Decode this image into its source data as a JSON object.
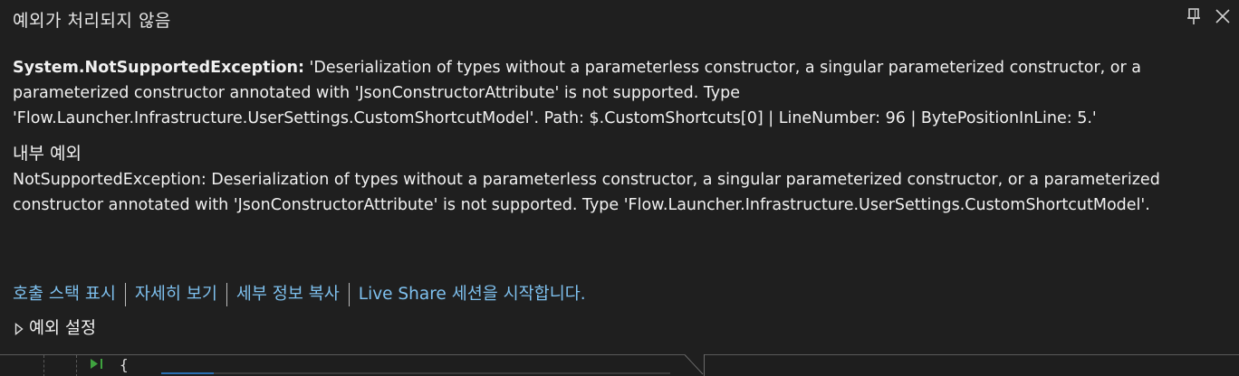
{
  "window": {
    "title": "예외가 처리되지 않음"
  },
  "exception": {
    "type": "System.NotSupportedException:",
    "message": " 'Deserialization of types without a parameterless constructor, a singular parameterized constructor, or a parameterized constructor annotated with 'JsonConstructorAttribute' is not supported. Type 'Flow.Launcher.Infrastructure.UserSettings.CustomShortcutModel'. Path: $.CustomShortcuts[0] | LineNumber: 96 | BytePositionInLine: 5.'"
  },
  "inner_exception": {
    "title": "내부 예외",
    "message": "NotSupportedException: Deserialization of types without a parameterless constructor, a singular parameterized constructor, or a parameterized constructor annotated with 'JsonConstructorAttribute' is not supported. Type 'Flow.Launcher.Infrastructure.UserSettings.CustomShortcutModel'."
  },
  "links": {
    "call_stack": "호출 스택 표시",
    "details": "자세히 보기",
    "copy_details": "세부 정보 복사",
    "live_share": "Live Share 세션을 시작합니다."
  },
  "exception_settings": {
    "label": "예외 설정"
  },
  "editor": {
    "line_text": "{"
  },
  "colors": {
    "background": "#1f1f1f",
    "link": "#7ec0ee",
    "text": "#f1f1f1"
  },
  "icons": [
    "pin-icon",
    "close-icon",
    "expand-triangle-icon",
    "execution-marker-icon"
  ]
}
